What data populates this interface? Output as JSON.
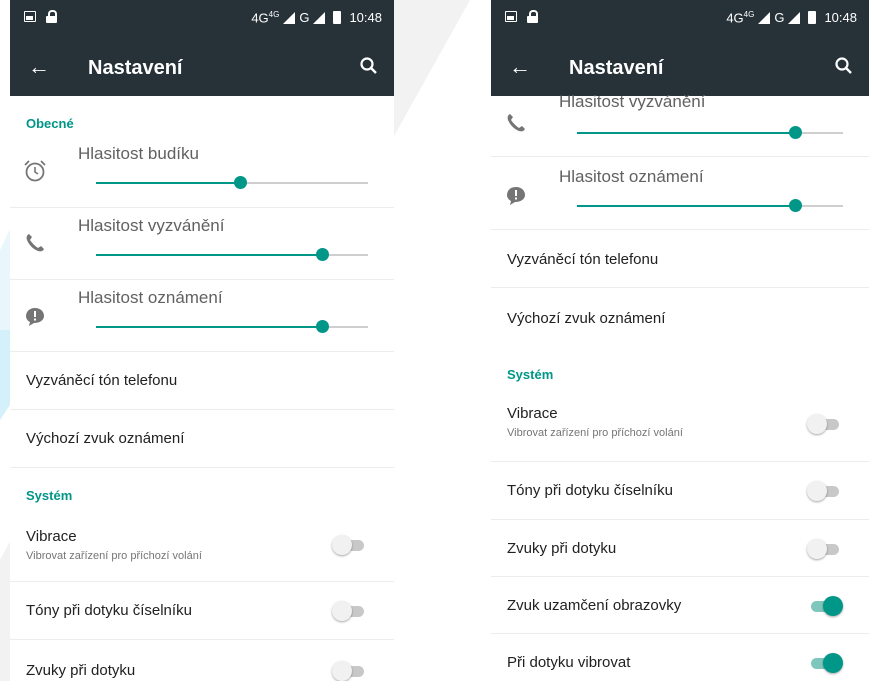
{
  "colors": {
    "accent": "#009688",
    "toolbar": "#263238"
  },
  "left_screen": {
    "status_bar": {
      "network": "4G",
      "network_sup": "4G",
      "network2": "G",
      "time": "10:48"
    },
    "toolbar": {
      "back_icon": "arrow-left-icon",
      "title": "Nastavení",
      "search_icon": "search-icon"
    },
    "section_general": "Obecné",
    "sliders": [
      {
        "label": "Hlasitost budíku",
        "icon": "alarm-clock-icon",
        "level": 0.53
      },
      {
        "label": "Hlasitost vyzvánění",
        "icon": "phone-icon",
        "level": 0.83
      },
      {
        "label": "Hlasitost oznámení",
        "icon": "notification-bubble-icon",
        "level": 0.83
      }
    ],
    "ringtone": "Vyzváněcí tón telefonu",
    "default_notification_sound": "Výchozí zvuk oznámení",
    "section_system": "Systém",
    "vibrate": {
      "label": "Vibrace",
      "summary": "Vibrovat zařízení pro příchozí volání",
      "on": false
    },
    "dialpad_tones": {
      "label": "Tóny při dotyku číselníku",
      "on": false
    },
    "touch_sounds": {
      "label": "Zvuky při dotyku",
      "on": false
    }
  },
  "right_screen": {
    "status_bar": {
      "network": "4G",
      "network_sup": "4G",
      "network2": "G",
      "time": "10:48"
    },
    "toolbar": {
      "back_icon": "arrow-left-icon",
      "title": "Nastavení",
      "search_icon": "search-icon"
    },
    "sliders": [
      {
        "label": "Hlasitost vyzvánění",
        "icon": "phone-icon",
        "level": 0.82
      },
      {
        "label": "Hlasitost oznámení",
        "icon": "notification-bubble-icon",
        "level": 0.82
      }
    ],
    "ringtone": "Vyzváněcí tón telefonu",
    "default_notification_sound": "Výchozí zvuk oznámení",
    "section_system": "Systém",
    "vibrate": {
      "label": "Vibrace",
      "summary": "Vibrovat zařízení pro příchozí volání",
      "on": false
    },
    "dialpad_tones": {
      "label": "Tóny při dotyku číselníku",
      "on": false
    },
    "touch_sounds": {
      "label": "Zvuky při dotyku",
      "on": false
    },
    "screen_lock_sound": {
      "label": "Zvuk uzamčení obrazovky",
      "on": true
    },
    "vibrate_on_touch": {
      "label": "Při dotyku vibrovat",
      "on": true
    }
  }
}
